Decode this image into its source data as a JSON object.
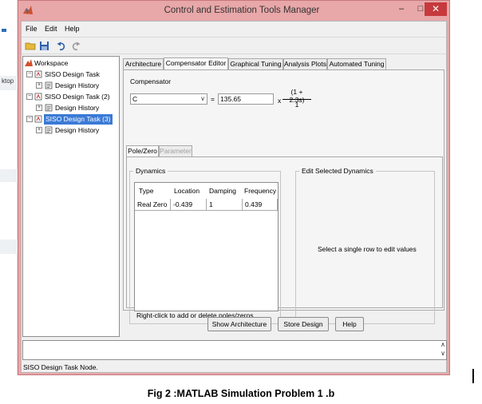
{
  "window": {
    "title": "Control and Estimation Tools Manager",
    "controls": {
      "minimize": "–",
      "maximize": "□",
      "close": "✕"
    }
  },
  "background": {
    "left_edge_text": "ktop"
  },
  "menu": [
    "File",
    "Edit",
    "Help"
  ],
  "toolbar": {
    "icons": [
      "open-folder-icon",
      "save-icon",
      "undo-icon",
      "redo-icon"
    ]
  },
  "tree": {
    "root": "Workspace",
    "items": [
      {
        "label": "SISO Design Task",
        "child": "Design History"
      },
      {
        "label": "SISO Design Task (2)",
        "child": "Design History"
      },
      {
        "label": "SISO Design Task (3)",
        "child": "Design History",
        "selected": true
      }
    ]
  },
  "tabs": [
    "Architecture",
    "Compensator Editor",
    "Graphical Tuning",
    "Analysis Plots",
    "Automated Tuning"
  ],
  "active_tab": "Compensator Editor",
  "compensator": {
    "group_label": "Compensator",
    "selected": "C",
    "equals": "=",
    "gain": "135.65",
    "times": "x",
    "numerator": "(1 + 2.3s)",
    "denominator": "1"
  },
  "subtabs": [
    {
      "label": "Pole/Zero",
      "active": true
    },
    {
      "label": "Parameter",
      "enabled": false
    }
  ],
  "dynamics": {
    "title": "Dynamics",
    "columns": [
      "Type",
      "Location",
      "Damping",
      "Frequency"
    ],
    "rows": [
      [
        "Real Zero",
        "-0.439",
        "1",
        "0.439"
      ]
    ],
    "hint": "Right-click to add or delete poles/zeros"
  },
  "edit_selected": {
    "title": "Edit Selected Dynamics",
    "message": "Select a single row to edit values"
  },
  "buttons": {
    "show_architecture": "Show Architecture",
    "store_design": "Store Design",
    "help": "Help"
  },
  "status": "SISO Design Task Node.",
  "caption": "Fig 2 :MATLAB Simulation Problem 1 .b",
  "colors": {
    "window_frame": "#e8a7a9",
    "close_button": "#c6393c",
    "selection": "#3a7ad6"
  }
}
